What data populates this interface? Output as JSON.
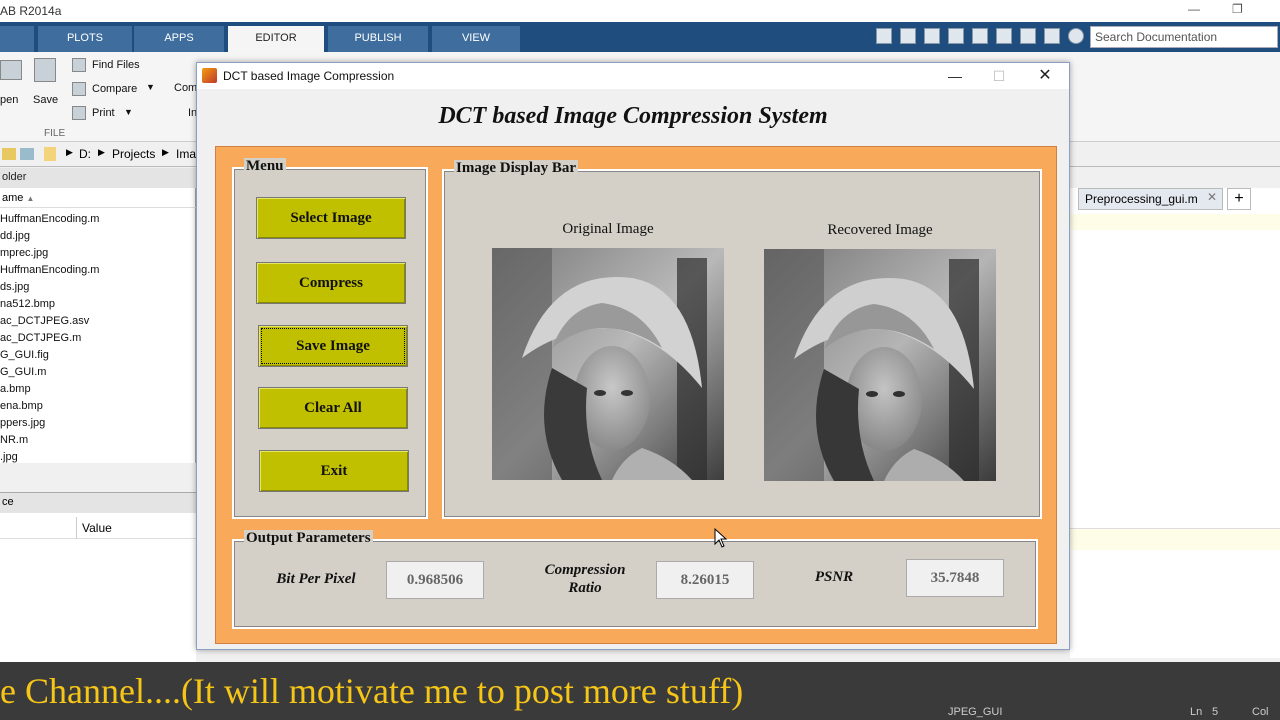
{
  "matlab": {
    "window_title": "AB R2014a",
    "tabs": [
      "PLOTS",
      "APPS",
      "EDITOR",
      "PUBLISH",
      "VIEW"
    ],
    "active_tab": "EDITOR",
    "search_placeholder": "Search Documentation",
    "ribbon": {
      "open_label": "pen",
      "save_label": "Save",
      "find_files_label": "Find Files",
      "compare_label": "Compare",
      "print_label": "Print",
      "file_group_label": "FILE",
      "comment_label": "Com",
      "indent_label": "In"
    },
    "path": [
      "D:",
      "Projects",
      "Ima"
    ],
    "folder_header": "older",
    "name_column": "ame",
    "files": [
      "HuffmanEncoding.m",
      "dd.jpg",
      "mprec.jpg",
      "HuffmanEncoding.m",
      "ds.jpg",
      "na512.bmp",
      "ac_DCTJPEG.asv",
      "ac_DCTJPEG.m",
      "G_GUI.fig",
      "G_GUI.m",
      "a.bmp",
      "ena.bmp",
      "ppers.jpg",
      "NR.m",
      ".jpg"
    ],
    "workspace_header": "ce",
    "value_column": "Value",
    "editor_tab": "Preprocessing_gui.m",
    "status": {
      "file": "JPEG_GUI",
      "ln_label": "Ln",
      "ln": "5",
      "col_label": "Col"
    }
  },
  "dialog": {
    "window_title": "DCT based Image Compression",
    "app_title": "DCT based Image Compression System",
    "menu": {
      "title": "Menu",
      "buttons": [
        "Select Image",
        "Compress",
        "Save Image",
        "Clear All",
        "Exit"
      ]
    },
    "display": {
      "title": "Image Display Bar",
      "original_label": "Original Image",
      "recovered_label": "Recovered Image"
    },
    "output": {
      "title": "Output Parameters",
      "bpp_label": "Bit Per Pixel",
      "bpp_value": "0.968506",
      "cr_label_line1": "Compression",
      "cr_label_line2": "Ratio",
      "cr_value": "8.26015",
      "psnr_label": "PSNR",
      "psnr_value": "35.7848"
    }
  },
  "subtitle": "e Channel....(It will motivate me to post more stuff)"
}
